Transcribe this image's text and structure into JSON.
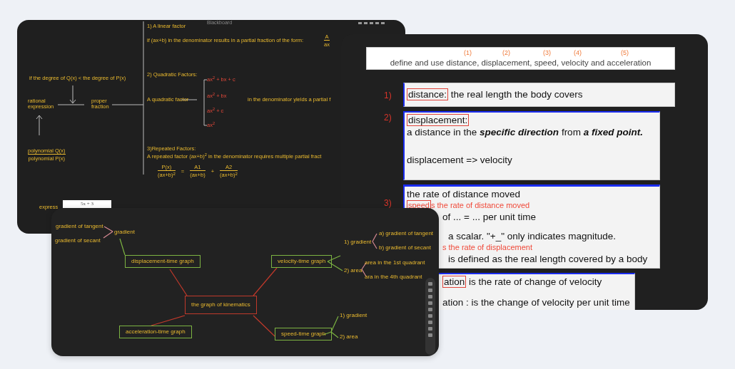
{
  "partial_fractions_board": {
    "title": "Blackboard",
    "notes": [
      {
        "kind": "note",
        "text": "1) A linear factor"
      },
      {
        "kind": "note",
        "text": "if (ax+b) in the denominator results in a partial fraction of the form:"
      },
      {
        "kind": "note",
        "text": "if the degree of Q(x) < the degree of P(x)"
      },
      {
        "kind": "note",
        "text": "2) Quadratic Factors:"
      },
      {
        "kind": "term",
        "text": "ax$^{2}$ + bx + c"
      },
      {
        "kind": "term",
        "text": "ax$^{2}$ + bx"
      },
      {
        "kind": "term",
        "text": "ax$^{2}$ + c"
      },
      {
        "kind": "term",
        "text": "ax$^{2}$"
      },
      {
        "kind": "note",
        "text": "rational expression"
      },
      {
        "kind": "note",
        "text": "proper fraction"
      },
      {
        "kind": "note",
        "text": "A quadratic factor"
      },
      {
        "kind": "note",
        "text": "in the denominator yields a partial f"
      },
      {
        "kind": "note",
        "text": "3)Repeated Factors:"
      },
      {
        "kind": "note",
        "text": "A repeated factor (ax+b)$^{2}$ in the denominator requires multiple partial fract"
      }
    ],
    "fractions": [
      {
        "numerator": "A",
        "denominator": "ax"
      },
      {
        "numerator": "polynomial Q(x)",
        "denominator": "polynomial P(x)"
      }
    ],
    "equation": [
      {
        "kind": "fraction",
        "numerator": "P(x)",
        "denominator": "(ax+b)$^{2}$"
      },
      {
        "kind": "operator",
        "text": "="
      },
      {
        "kind": "fraction",
        "numerator": "A1",
        "denominator": "(ax+b)"
      },
      {
        "kind": "operator",
        "text": "+"
      },
      {
        "kind": "fraction",
        "numerator": "A2",
        "denominator": "(ax+b)$^{2}$"
      }
    ],
    "exercise": {
      "label": "express",
      "value": "5x + 3"
    }
  },
  "lesson_slide": {
    "heading": "define and use distance, displacement, speed, velocity and acceleration",
    "heading_marks": [
      "(1)",
      "(2)",
      "(3)",
      "(4)",
      "(5)"
    ],
    "definitions": [
      {
        "number": "1)",
        "lines": [
          {
            "kind": "text",
            "highlight": "distance:",
            "text": " the real length the body covers"
          }
        ]
      },
      {
        "number": "2)",
        "lines": [
          {
            "kind": "text",
            "highlight": "displacement:"
          },
          {
            "kind": "text",
            "text": "a distance in the **specific direction** from **a fixed point.**"
          },
          {
            "kind": "text",
            "text": "displacement => velocity"
          }
        ]
      },
      {
        "number": "3)",
        "lines": [
          {
            "kind": "text",
            "text": "the rate of distance moved"
          },
          {
            "kind": "annotation",
            "highlight": "speed",
            "text": "s the rate of distance moved"
          },
          {
            "kind": "covered",
            "text": "of ... = ... per unit time"
          },
          {
            "kind": "covered",
            "text": "a scalar. \"+_\" only indicates magnitude."
          },
          {
            "kind": "covered_annotation",
            "text": "s the rate of displacement"
          },
          {
            "kind": "covered",
            "text": "is defined as the real length covered by a body"
          }
        ]
      },
      {
        "lines": [
          {
            "kind": "covered",
            "highlight": "ation",
            "text": " is the rate of change of velocity"
          },
          {
            "kind": "covered",
            "text": "ation : is the change of velocity per unit time"
          }
        ]
      }
    ]
  },
  "mind_map": {
    "center": "the graph of kinematics",
    "branches": [
      {
        "label": "displacement-time graph",
        "children": [
          {
            "label": "gradient",
            "children": [
              {
                "label": "gradient of tangent"
              },
              {
                "label": "gradient of secant"
              }
            ]
          }
        ]
      },
      {
        "label": "velocity-time graph",
        "children": [
          {
            "label": "1) gradient",
            "children": [
              {
                "label": "a) gradient of tangent"
              },
              {
                "label": "b) gradient of secant"
              }
            ]
          },
          {
            "label": "2) area",
            "children": [
              {
                "label": "area in the 1st quadrant"
              },
              {
                "label": "ara in the 4th quadrant"
              }
            ]
          }
        ]
      },
      {
        "label": "acceleration-time graph"
      },
      {
        "label": "speed-time graph",
        "children": [
          {
            "label": "1) gradient"
          },
          {
            "label": "2) area"
          }
        ]
      }
    ]
  }
}
